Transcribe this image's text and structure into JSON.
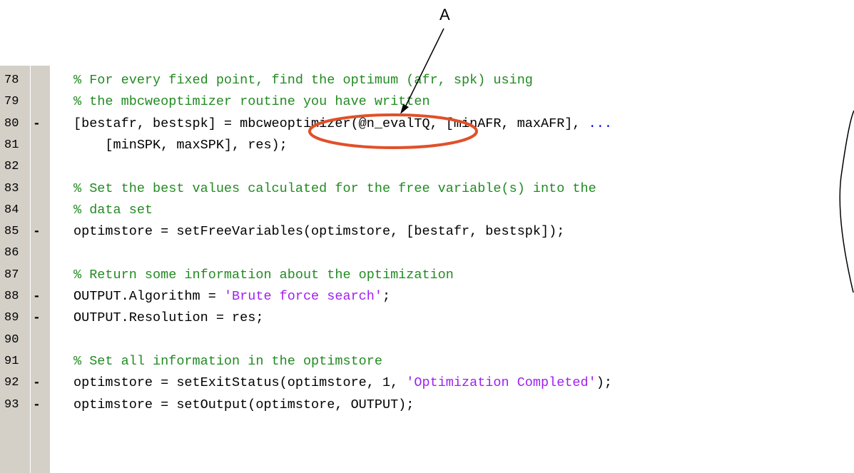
{
  "callout": {
    "label": "A"
  },
  "editor": {
    "lines": [
      {
        "num": "78",
        "mark": "",
        "segments": [
          {
            "t": "% For every fixed point, find the optimum (afr, spk) using",
            "c": "cm"
          }
        ]
      },
      {
        "num": "79",
        "mark": "",
        "segments": [
          {
            "t": "% the mbcweoptimizer routine you have written",
            "c": "cm"
          }
        ]
      },
      {
        "num": "80",
        "mark": "-",
        "segments": [
          {
            "t": "[bestafr, bestspk] = mbcweoptimizer(@n_evalTQ, [minAFR, maxAFR], ",
            "c": ""
          },
          {
            "t": "...",
            "c": "kw"
          }
        ]
      },
      {
        "num": "81",
        "mark": "",
        "segments": [
          {
            "t": "    [minSPK, maxSPK], res);",
            "c": ""
          }
        ]
      },
      {
        "num": "82",
        "mark": "",
        "segments": []
      },
      {
        "num": "83",
        "mark": "",
        "segments": [
          {
            "t": "% Set the best values calculated for the free variable(s) into the",
            "c": "cm"
          }
        ]
      },
      {
        "num": "84",
        "mark": "",
        "segments": [
          {
            "t": "% data set",
            "c": "cm"
          }
        ]
      },
      {
        "num": "85",
        "mark": "-",
        "segments": [
          {
            "t": "optimstore = setFreeVariables(optimstore, [bestafr, bestspk]);",
            "c": ""
          }
        ]
      },
      {
        "num": "86",
        "mark": "",
        "segments": []
      },
      {
        "num": "87",
        "mark": "",
        "segments": [
          {
            "t": "% Return some information about the optimization",
            "c": "cm"
          }
        ]
      },
      {
        "num": "88",
        "mark": "-",
        "segments": [
          {
            "t": "OUTPUT.Algorithm = ",
            "c": ""
          },
          {
            "t": "'Brute force search'",
            "c": "str"
          },
          {
            "t": ";",
            "c": ""
          }
        ]
      },
      {
        "num": "89",
        "mark": "-",
        "segments": [
          {
            "t": "OUTPUT.Resolution = res;",
            "c": ""
          }
        ]
      },
      {
        "num": "90",
        "mark": "",
        "segments": []
      },
      {
        "num": "91",
        "mark": "",
        "segments": [
          {
            "t": "% Set all information in the optimstore",
            "c": "cm"
          }
        ]
      },
      {
        "num": "92",
        "mark": "-",
        "segments": [
          {
            "t": "optimstore = setExitStatus(optimstore, 1, ",
            "c": ""
          },
          {
            "t": "'Optimization Completed'",
            "c": "str"
          },
          {
            "t": ");",
            "c": ""
          }
        ]
      },
      {
        "num": "93",
        "mark": "-",
        "segments": [
          {
            "t": "optimstore = setOutput(optimstore, OUTPUT);",
            "c": ""
          }
        ]
      }
    ]
  },
  "colors": {
    "gutter": "#d4d0c8",
    "comment": "#228b22",
    "string": "#a020f0",
    "continuation": "#0000ff",
    "highlight": "#e0502a"
  }
}
